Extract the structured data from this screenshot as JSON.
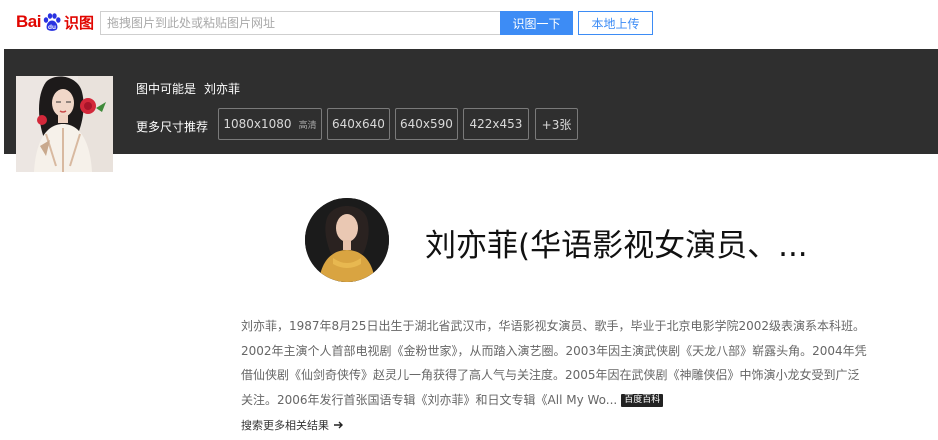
{
  "header": {
    "logo_text_1": "Bai",
    "logo_text_2": "du",
    "logo_text_3": "识图",
    "search_placeholder": "拖拽图片到此处或粘贴图片网址",
    "search_button": "识图一下",
    "upload_button": "本地上传"
  },
  "banner": {
    "guess_label": "图中可能是",
    "guess_name": "刘亦菲",
    "sizes_label": "更多尺寸推荐",
    "sizes": [
      {
        "label": "1080x1080",
        "tag": "高清"
      },
      {
        "label": "640x640",
        "tag": ""
      },
      {
        "label": "640x590",
        "tag": ""
      },
      {
        "label": "422x453",
        "tag": ""
      },
      {
        "label": "+3张",
        "tag": ""
      }
    ]
  },
  "entity": {
    "title": "刘亦菲(华语影视女演员、...",
    "description_lines": [
      "刘亦菲，1987年8月25日出生于湖北省武汉市，华语影视女演员、歌手，毕业于北京电影学院2002级表演系本科班。",
      "2002年主演个人首部电视剧《金粉世家》，从而踏入演艺圈。2003年因主演武侠剧《天龙八部》崭露头角。2004年凭",
      "借仙侠剧《仙剑奇侠传》赵灵儿一角获得了高人气与关注度。2005年因在武侠剧《神雕侠侣》中饰演小龙女受到广泛",
      "关注。2006年发行首张国语专辑《刘亦菲》和日文专辑《All My Wo..."
    ],
    "baike_badge": "百度百科",
    "more_link": "搜索更多相关结果"
  },
  "colors": {
    "brand_red": "#e10601",
    "brand_blue": "#2932e1",
    "accent_blue": "#3d8cf5",
    "banner_bg": "#2f2f2f"
  }
}
